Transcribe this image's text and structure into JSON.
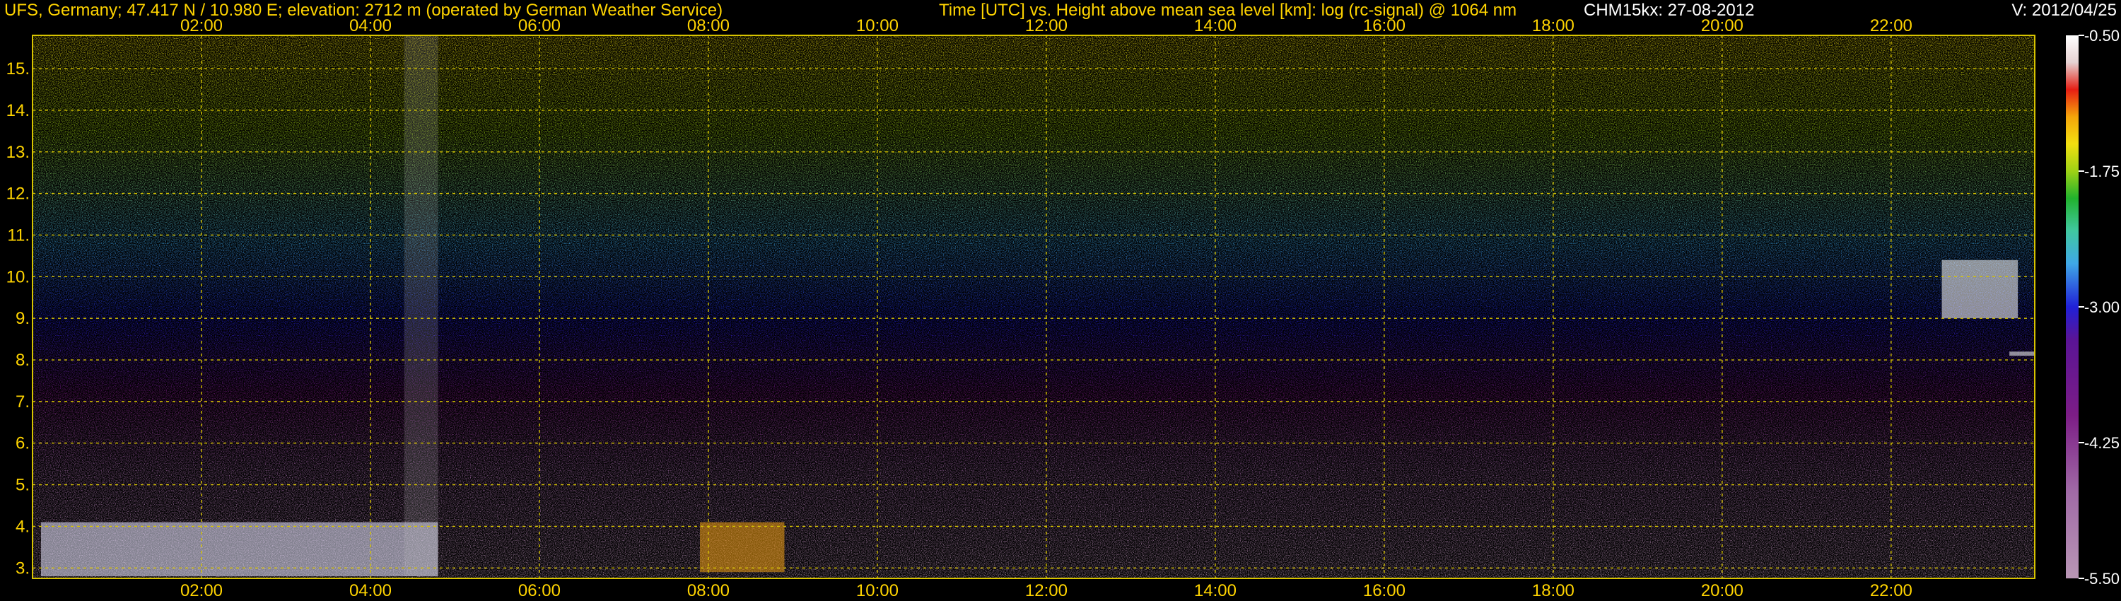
{
  "header": {
    "station": "UFS, Germany; 47.417 N / 10.980 E; elevation: 2712 m  (operated by German Weather Service)",
    "plot_title": "Time [UTC] vs. Height above mean sea level [km]: log (rc-signal) @ 1064 nm",
    "instrument_date": "CHM15kx: 27-08-2012",
    "version": "V: 2012/04/25"
  },
  "colors": {
    "header_text": "#FFD400",
    "version_text": "#FFFFFF",
    "grid": "#D8C400",
    "background": "#000000"
  },
  "chart_data": {
    "type": "heatmap",
    "title": "Time [UTC] vs. Height above mean sea level [km]: log (rc-signal) @ 1064 nm",
    "x": {
      "min": 0.0,
      "max": 23.7,
      "unit": "hour UTC",
      "ticks": [
        2,
        4,
        6,
        8,
        10,
        12,
        14,
        16,
        18,
        20,
        22
      ],
      "tick_labels": [
        "02:00",
        "04:00",
        "06:00",
        "08:00",
        "10:00",
        "12:00",
        "14:00",
        "16:00",
        "18:00",
        "20:00",
        "22:00"
      ]
    },
    "y": {
      "min": 2.75,
      "max": 15.8,
      "unit": "km",
      "ticks": [
        3,
        4,
        5,
        6,
        7,
        8,
        9,
        10,
        11,
        12,
        13,
        14,
        15
      ],
      "tick_labels": [
        "3.",
        "4.",
        "5.",
        "6.",
        "7.",
        "8.",
        "9.",
        "10.",
        "11.",
        "12.",
        "13.",
        "14.",
        "15."
      ]
    },
    "colorbar": {
      "min": -5.5,
      "max": -0.5,
      "tick_values": [
        -0.5,
        -1.75,
        -3.0,
        -4.25,
        -5.5
      ],
      "tick_labels": [
        "-0.50",
        "-1.75",
        "-3.00",
        "-4.25",
        "-5.50"
      ],
      "stops": [
        [
          -5.5,
          "#b996b5"
        ],
        [
          -4.7,
          "#a06aa6"
        ],
        [
          -4.0,
          "#7c1d86"
        ],
        [
          -3.3,
          "#5a1496"
        ],
        [
          -3.0,
          "#2020d8"
        ],
        [
          -2.6,
          "#3fa8e6"
        ],
        [
          -2.3,
          "#40c8a0"
        ],
        [
          -2.0,
          "#21b22d"
        ],
        [
          -1.75,
          "#9ed215"
        ],
        [
          -1.5,
          "#f2df10"
        ],
        [
          -1.25,
          "#f5a50a"
        ],
        [
          -1.0,
          "#e61e14"
        ],
        [
          -0.75,
          "#e6d2d2"
        ],
        [
          -0.5,
          "#ffffff"
        ]
      ]
    },
    "grid": true,
    "features": [
      {
        "kind": "boundary_layer_clouds",
        "x_range": [
          0.1,
          4.8
        ],
        "y_range": [
          2.8,
          4.1
        ]
      },
      {
        "kind": "convective_cells",
        "x_range": [
          7.9,
          8.9
        ],
        "y_range": [
          2.9,
          4.1
        ]
      },
      {
        "kind": "cirrus",
        "x_range": [
          22.6,
          23.5
        ],
        "y_range": [
          9.0,
          10.4
        ]
      },
      {
        "kind": "thin_layer",
        "x_range": [
          23.4,
          23.7
        ],
        "y_range": [
          8.1,
          8.2
        ]
      },
      {
        "kind": "data_gap_noise_column",
        "x_range": [
          4.4,
          4.8
        ],
        "y_range": [
          2.8,
          15.8
        ]
      }
    ]
  }
}
